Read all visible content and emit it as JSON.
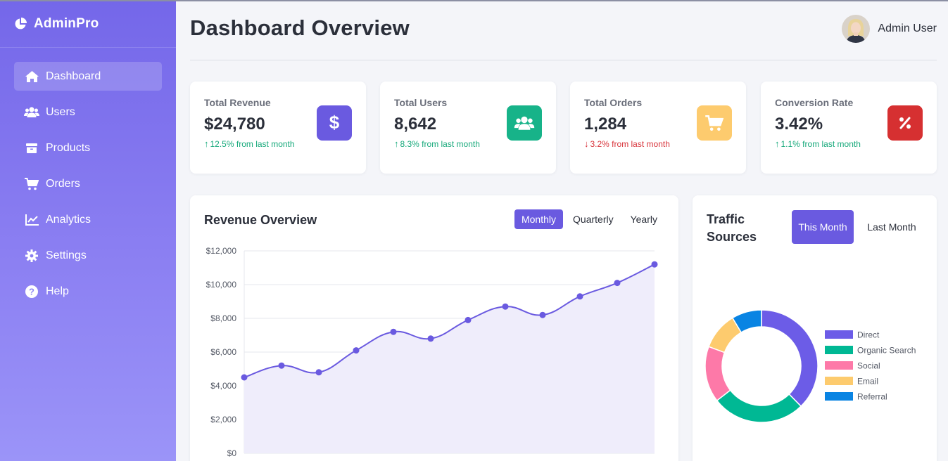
{
  "brand": {
    "name": "AdminPro"
  },
  "sidebar": {
    "items": [
      {
        "label": "Dashboard",
        "icon": "home-icon",
        "active": true
      },
      {
        "label": "Users",
        "icon": "users-icon",
        "active": false
      },
      {
        "label": "Products",
        "icon": "box-icon",
        "active": false
      },
      {
        "label": "Orders",
        "icon": "cart-icon",
        "active": false
      },
      {
        "label": "Analytics",
        "icon": "chart-line-icon",
        "active": false
      },
      {
        "label": "Settings",
        "icon": "gear-icon",
        "active": false
      },
      {
        "label": "Help",
        "icon": "help-icon",
        "active": false
      }
    ]
  },
  "header": {
    "title": "Dashboard Overview",
    "user_name": "Admin User"
  },
  "stats": [
    {
      "label": "Total Revenue",
      "value": "$24,780",
      "change": "12.5% from last month",
      "trend": "up",
      "icon": "dollar-icon",
      "color": "#6a5ae0"
    },
    {
      "label": "Total Users",
      "value": "8,642",
      "change": "8.3% from last month",
      "trend": "up",
      "icon": "users-icon",
      "color": "#17b389"
    },
    {
      "label": "Total Orders",
      "value": "1,284",
      "change": "3.2% from last month",
      "trend": "down",
      "icon": "cart-icon",
      "color": "#fdcb6e"
    },
    {
      "label": "Conversion Rate",
      "value": "3.42%",
      "change": "1.1% from last month",
      "trend": "up",
      "icon": "percent-icon",
      "color": "#d63031"
    }
  ],
  "revenue": {
    "title": "Revenue Overview",
    "tabs": [
      {
        "label": "Monthly",
        "active": true
      },
      {
        "label": "Quarterly",
        "active": false
      },
      {
        "label": "Yearly",
        "active": false
      }
    ]
  },
  "traffic": {
    "title": "Traffic Sources",
    "tabs": [
      {
        "label": "This Month",
        "active": true
      },
      {
        "label": "Last Month",
        "active": false
      }
    ]
  },
  "chart_data": [
    {
      "type": "area",
      "title": "Revenue Overview",
      "y": [
        4500,
        5200,
        4800,
        6100,
        7200,
        6800,
        7900,
        8700,
        8200,
        9300,
        10100,
        11200
      ],
      "ylim": [
        0,
        12000
      ],
      "yticks": [
        "$0",
        "$2,000",
        "$4,000",
        "$6,000",
        "$8,000",
        "$10,000",
        "$12,000"
      ],
      "line_color": "#6a5ae0",
      "fill_color": "#efedfb",
      "grid": true
    },
    {
      "type": "pie",
      "title": "Traffic Sources",
      "labels": [
        "Direct",
        "Organic Search",
        "Social",
        "Email",
        "Referral"
      ],
      "values": [
        35,
        25,
        15,
        10,
        8
      ],
      "colors": [
        "#6c5ce7",
        "#00b894",
        "#fd79a8",
        "#fdcb6e",
        "#0984e3"
      ],
      "legend": "right"
    }
  ]
}
